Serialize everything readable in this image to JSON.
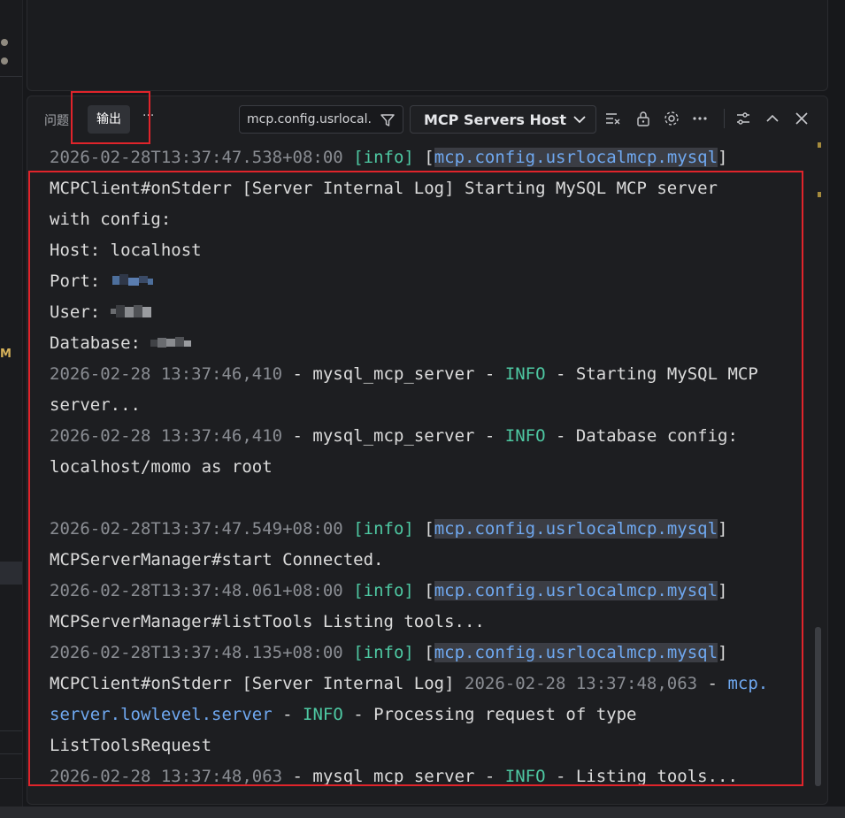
{
  "tabs": {
    "problems": "问题",
    "output": "输出",
    "more": "···"
  },
  "filter": {
    "value": "mcp.config.usrlocal..."
  },
  "channel": {
    "selected": "MCP Servers Host"
  },
  "sidebar": {
    "fragment_label": "M"
  },
  "log": {
    "line1": {
      "ts": "2026-02-28T13:37:47.538+08:00",
      "level": "[info]",
      "open": "[",
      "source": "mcp.config.usrlocalmcp.mysql",
      "close": "]"
    },
    "line2": "MCPClient#onStderr [Server Internal Log] Starting MySQL MCP server",
    "line3": "with config:",
    "line4_label": "Host:",
    "line4_value": "localhost",
    "line5_label": "Port:",
    "line6_label": "User:",
    "line7_label": "Database:",
    "line8": {
      "ts": "2026-02-28 13:37:46,410",
      "dash1": " - mysql_mcp_server - ",
      "level": "INFO",
      "msg": " - Starting MySQL MCP"
    },
    "line9": "server...",
    "line10": {
      "ts": "2026-02-28 13:37:46,410",
      "dash1": " - mysql_mcp_server - ",
      "level": "INFO",
      "msg": " - Database config:"
    },
    "line11": "localhost/momo as root",
    "line13": {
      "ts": "2026-02-28T13:37:47.549+08:00",
      "level": "[info]",
      "open": "[",
      "source": "mcp.config.usrlocalmcp.mysql",
      "close": "]"
    },
    "line14": "MCPServerManager#start Connected.",
    "line15": {
      "ts": "2026-02-28T13:37:48.061+08:00",
      "level": "[info]",
      "open": "[",
      "source": "mcp.config.usrlocalmcp.mysql",
      "close": "]"
    },
    "line16": "MCPServerManager#listTools Listing tools...",
    "line17": {
      "ts": "2026-02-28T13:37:48.135+08:00",
      "level": "[info]",
      "open": "[",
      "source": "mcp.config.usrlocalmcp.mysql",
      "close": "]"
    },
    "line18": {
      "prefix": "MCPClient#onStderr [Server Internal Log] ",
      "ts": "2026-02-28 13:37:48,063",
      "dash": " - ",
      "src": "mcp."
    },
    "line19": {
      "src": "server.lowlevel.server",
      "dash": " - ",
      "level": "INFO",
      "msg": " - Processing request of type"
    },
    "line20": "ListToolsRequest",
    "line21": {
      "ts": "2026-02-28 13:37:48,063",
      "dash1": " - mysql_mcp_server - ",
      "level": "INFO",
      "msg": " - Listing tools..."
    }
  },
  "colors": {
    "highlight_box": "#e0242b",
    "info_level": "#4ec9a3",
    "source_link": "#6fa8f0",
    "timestamp": "#8a8d93"
  },
  "icons": [
    "filter-icon",
    "chevron-down-icon",
    "clear-output-icon",
    "lock-icon",
    "gear-icon",
    "more-icon",
    "panel-settings-icon",
    "chevron-up-icon",
    "close-icon"
  ]
}
